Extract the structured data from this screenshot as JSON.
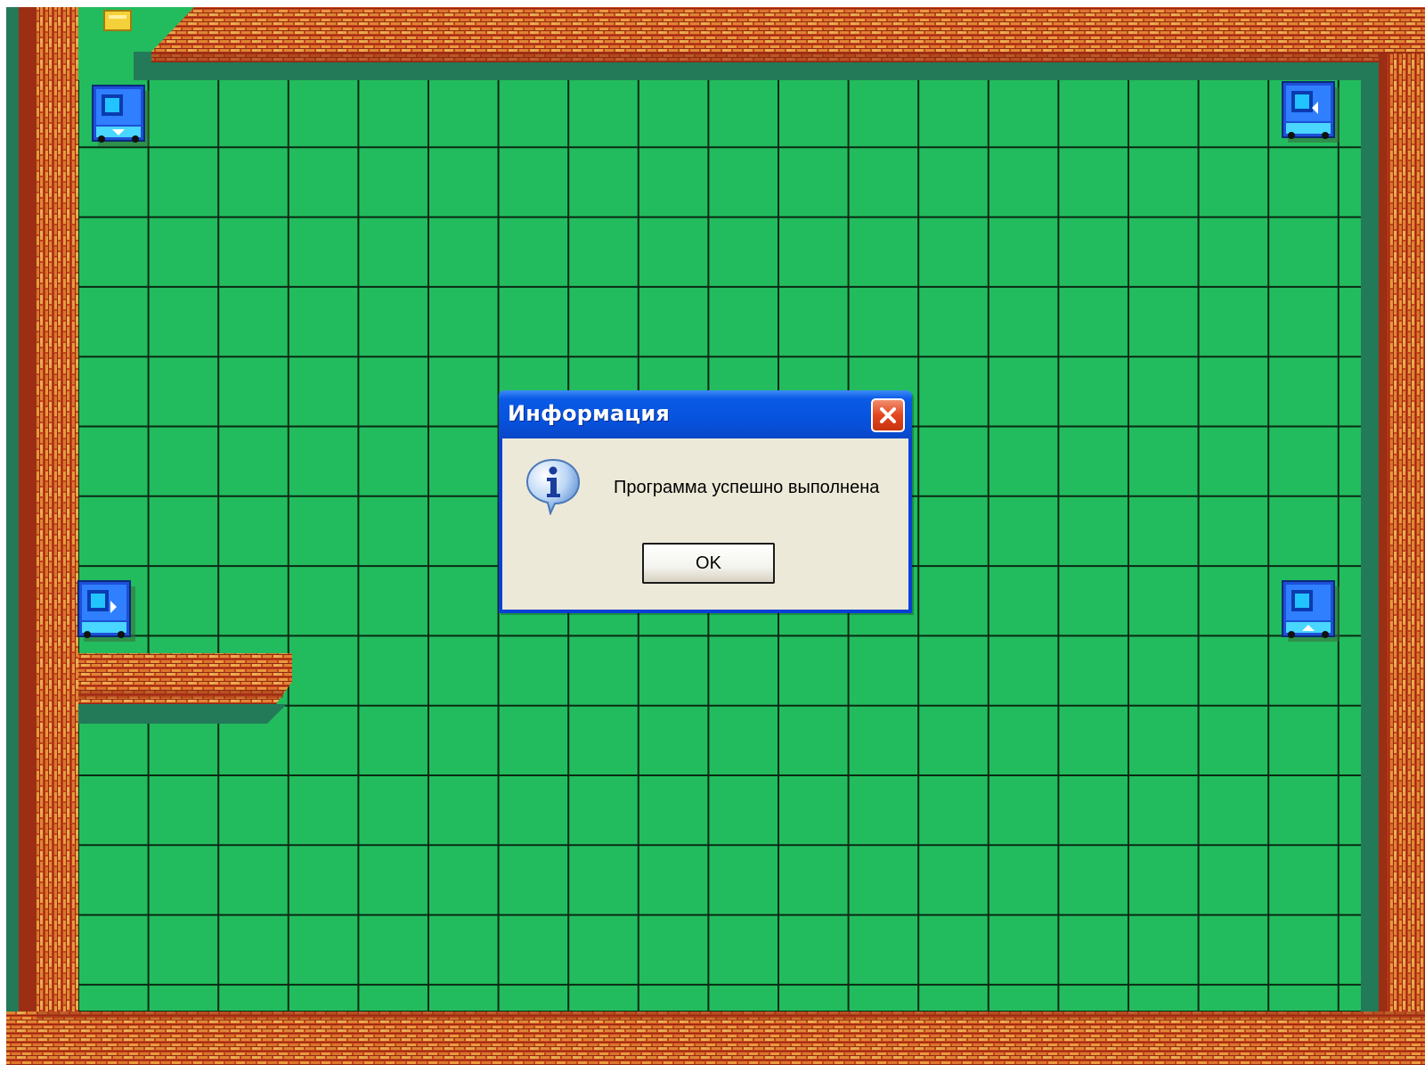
{
  "dialog": {
    "title": "Информация",
    "message": "Программа успешно выполнена",
    "ok_label": "OK",
    "icon": "info-icon",
    "close_icon": "close-icon"
  },
  "field": {
    "columns": 18,
    "rows": 14,
    "grass_color": "#22bc5e",
    "grid_line_color": "#0b2a14",
    "wall_color": "#c8431c",
    "brick_highlight": "#e7a54a",
    "shadow_color": "#227a58"
  },
  "robots": [
    {
      "name": "robot-top-left",
      "facing": "down"
    },
    {
      "name": "robot-top-right",
      "facing": "left"
    },
    {
      "name": "robot-left-middle",
      "facing": "right"
    },
    {
      "name": "robot-right-middle",
      "facing": "up"
    }
  ],
  "icons": [
    "brick-wall-icon",
    "robot-icon",
    "door-marker-icon"
  ]
}
